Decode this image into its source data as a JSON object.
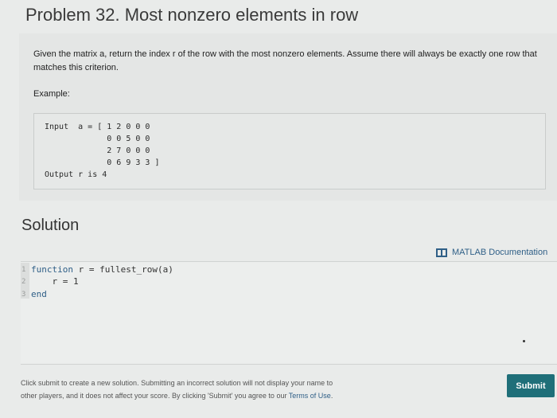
{
  "problem": {
    "title": "Problem 32. Most nonzero elements in row",
    "description": "Given the matrix a, return the index r of the row with the most nonzero elements. Assume there will always be exactly one row that matches this criterion.",
    "example_label": "Example:",
    "example_text": "Input  a = [ 1 2 0 0 0\n             0 0 5 0 0\n             2 7 0 0 0\n             0 6 9 3 3 ]\nOutput r is 4"
  },
  "solution": {
    "heading": "Solution",
    "doc_link": "MATLAB Documentation",
    "code": [
      {
        "line_no": "1",
        "keyword": "function",
        "text": " r = fullest_row(a)"
      },
      {
        "line_no": "2",
        "keyword": "",
        "text": "    r = 1"
      },
      {
        "line_no": "3",
        "keyword": "end",
        "text": ""
      }
    ]
  },
  "footer": {
    "text_before": "Click submit to create a new solution. Submitting an incorrect solution will not display your name to other players, and it does not affect your score. By clicking 'Submit' you agree to our ",
    "terms_link": "Terms of Use",
    "text_after": ".",
    "submit_label": "Submit"
  },
  "colors": {
    "accent": "#2f5f87",
    "submit": "#1f6f79"
  },
  "icons": {
    "doc_link": "documentation-icon"
  }
}
